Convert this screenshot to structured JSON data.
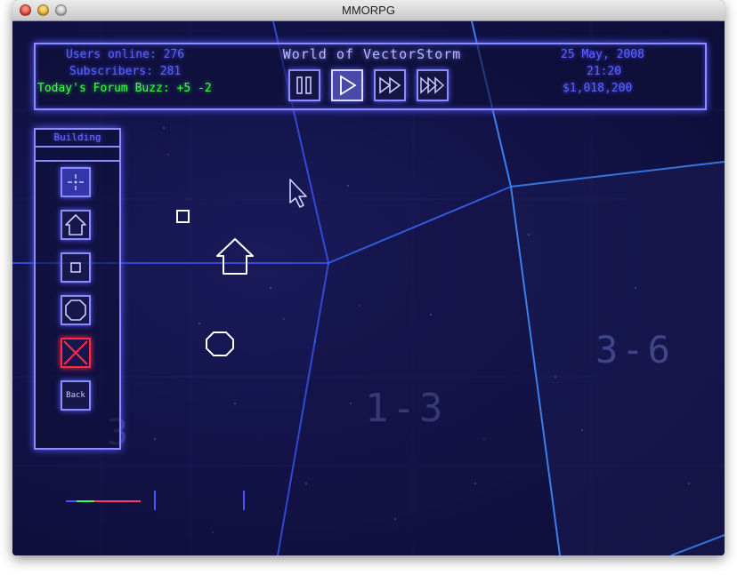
{
  "window": {
    "title": "MMORPG"
  },
  "hud": {
    "title": "World of VectorStorm",
    "users_online": "Users online: 276",
    "subscribers": "Subscribers: 281",
    "forum_buzz": "Today's Forum Buzz: +5 -2",
    "date": "25 May, 2008",
    "time": "21:20",
    "money": "$1,018,200",
    "controls": [
      "pause",
      "play",
      "fast-forward",
      "fastest-forward"
    ],
    "active_control": "play"
  },
  "build_panel": {
    "title": "Building",
    "tools": [
      "move-tool",
      "house-tool",
      "square-tool",
      "octagon-tool",
      "delete-tool",
      "back"
    ],
    "back_label": "Back",
    "active_tool": "move-tool"
  },
  "map": {
    "sector_labels": [
      "1-3",
      "3-6",
      "3"
    ]
  },
  "colors": {
    "hud_text": "#5c63ff",
    "buzz_text": "#3cff4a",
    "frame": "#8a8cff",
    "grid_line": "#3f8cff",
    "delete": "#ff2a4a"
  }
}
